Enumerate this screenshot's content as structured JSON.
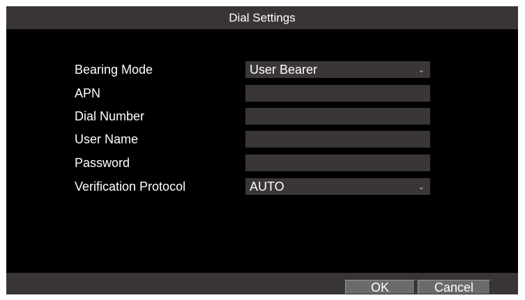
{
  "dialog": {
    "title": "Dial Settings"
  },
  "fields": {
    "bearing_mode": {
      "label": "Bearing Mode",
      "value": "User Bearer"
    },
    "apn": {
      "label": "APN",
      "value": ""
    },
    "dial_number": {
      "label": "Dial Number",
      "value": ""
    },
    "user_name": {
      "label": "User Name",
      "value": ""
    },
    "password": {
      "label": "Password",
      "value": ""
    },
    "verification_protocol": {
      "label": "Verification Protocol",
      "value": "AUTO"
    }
  },
  "buttons": {
    "ok": "OK",
    "cancel": "Cancel"
  },
  "icons": {
    "dropdown": "chevron-down-icon"
  },
  "colors": {
    "background": "#000000",
    "bar": "#3a3535",
    "field": "#3b3636",
    "button": "#6b6b6b",
    "text": "#ffffff"
  }
}
